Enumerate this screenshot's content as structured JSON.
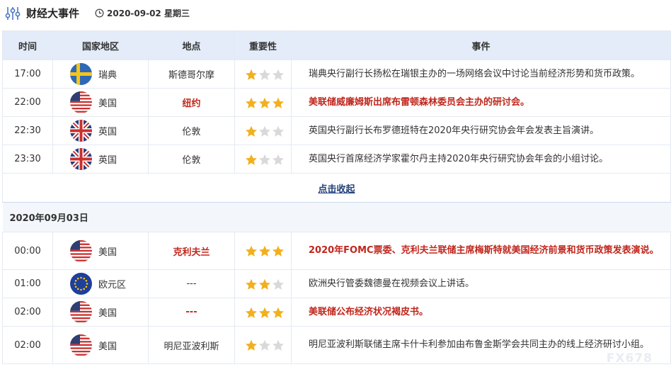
{
  "header": {
    "title": "财经大事件",
    "date": "2020-09-02 星期三"
  },
  "columns": {
    "time": "时间",
    "country": "国家地区",
    "location": "地点",
    "importance": "重要性",
    "event": "事件"
  },
  "day1_rows": [
    {
      "time": "17:00",
      "country": "瑞典",
      "flag": "sweden-flag",
      "location": "斯德哥尔摩",
      "stars": 1,
      "event": "瑞典央行副行长扬松在瑞银主办的一场网络会议中讨论当前经济形势和货币政策。"
    },
    {
      "time": "22:00",
      "country": "美国",
      "flag": "usa-flag",
      "location": "纽约",
      "stars": 3,
      "event": "美联储威廉姆斯出席布雷顿森林委员会主办的研讨会。"
    },
    {
      "time": "22:30",
      "country": "英国",
      "flag": "uk-flag",
      "location": "伦敦",
      "stars": 1,
      "event": "英国央行副行长布罗德班特在2020年央行研究协会年会发表主旨演讲。"
    },
    {
      "time": "23:30",
      "country": "英国",
      "flag": "uk-flag",
      "location": "伦敦",
      "stars": 1,
      "event": "英国央行首席经济学家霍尔丹主持2020年央行研究协会年会的小组讨论。"
    }
  ],
  "collapse_label": "点击收起",
  "date_heading": "2020年09月03日",
  "day2_rows": [
    {
      "time": "00:00",
      "country": "美国",
      "flag": "usa-flag",
      "location": "克利夫兰",
      "stars": 3,
      "event": "2020年FOMC票委、克利夫兰联储主席梅斯特就美国经济前景和货币政策发表演说。"
    },
    {
      "time": "01:00",
      "country": "欧元区",
      "flag": "eu-flag",
      "location": "---",
      "stars": 2,
      "event": "欧洲央行管委魏德曼在视频会议上讲话。"
    },
    {
      "time": "02:00",
      "country": "美国",
      "flag": "usa-flag",
      "location": "---",
      "stars": 3,
      "event": "美联储公布经济状况褐皮书。"
    },
    {
      "time": "02:00",
      "country": "美国",
      "flag": "usa-flag",
      "location": "明尼亚波利斯",
      "stars": 1,
      "event": "明尼亚波利斯联储主席卡什卡利参加由布鲁金斯学会共同主办的线上经济研讨小组。"
    }
  ],
  "watermark": "FX678",
  "colors": {
    "header_bg": "#e3ecf8",
    "highlight": "#c0261c",
    "star_on": "#f2b01e",
    "star_off": "#d9d9d9",
    "link": "#24407a"
  }
}
